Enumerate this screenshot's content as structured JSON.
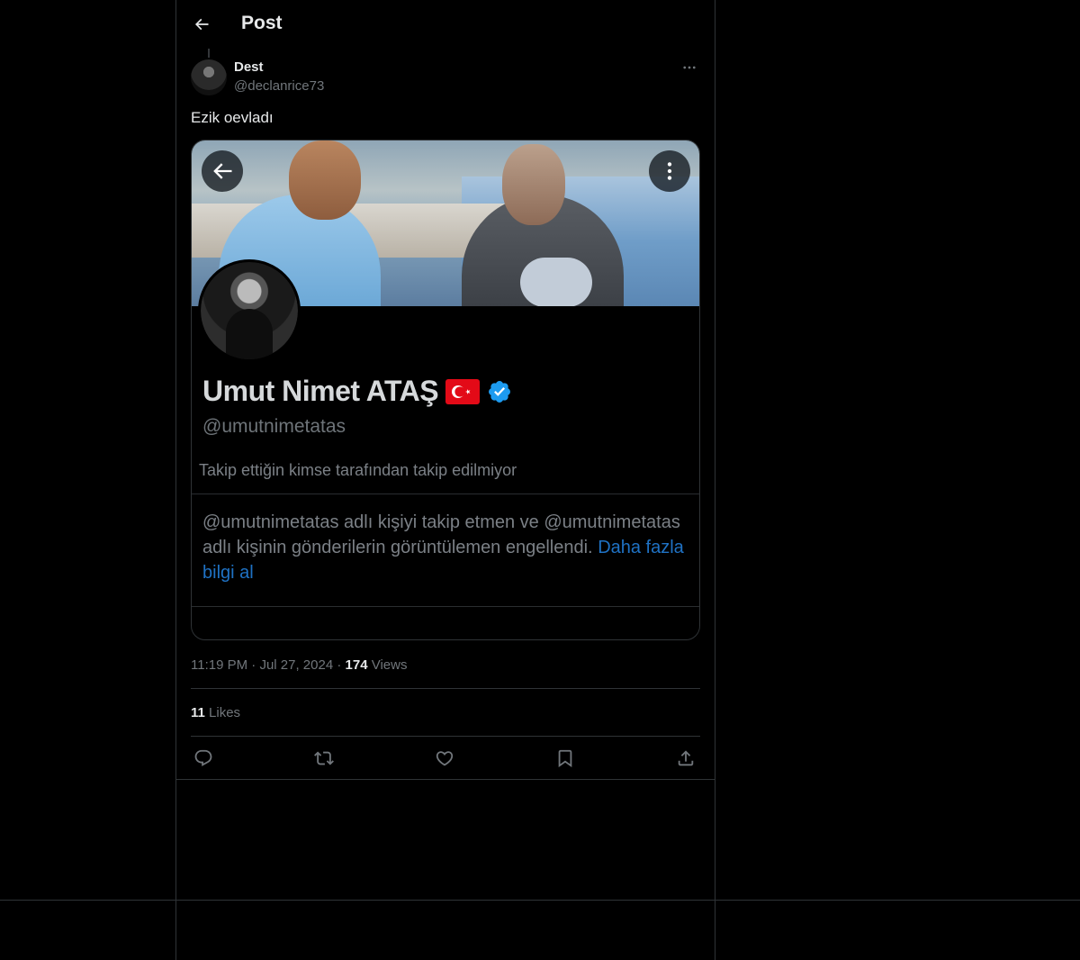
{
  "header": {
    "title": "Post"
  },
  "post": {
    "author_name": "Dest",
    "author_handle": "@declanrice73",
    "text": "Ezik oevladı",
    "time": "11:19 PM",
    "date": "Jul 27, 2024",
    "views_count": "174",
    "views_label": "Views",
    "likes_count": "11",
    "likes_label": "Likes"
  },
  "embedded_profile": {
    "name": "Umut Nimet ATAŞ",
    "flag_emoji": "🇹🇷",
    "handle": "@umutnimetatas",
    "follow_note": "Takip ettiğin kimse tarafından takip edilmiyor",
    "blocked_text": "@umutnimetatas adlı kişiyi takip etmen ve @umutnimetatas adlı kişinin gönderilerin görüntülemen engellendi.",
    "learn_more": "Daha fazla bilgi al"
  },
  "icons": {
    "back": "arrow-left-icon",
    "more": "more-horizontal-icon",
    "reply": "reply-icon",
    "repost": "repost-icon",
    "like": "heart-icon",
    "bookmark": "bookmark-icon",
    "share": "share-icon",
    "verified": "verified-badge-icon"
  },
  "colors": {
    "background": "#000000",
    "text": "#e7e9ea",
    "secondary": "#71767b",
    "border": "#2f3336",
    "link": "#1d9bf0",
    "verified": "#1d9bf0"
  }
}
